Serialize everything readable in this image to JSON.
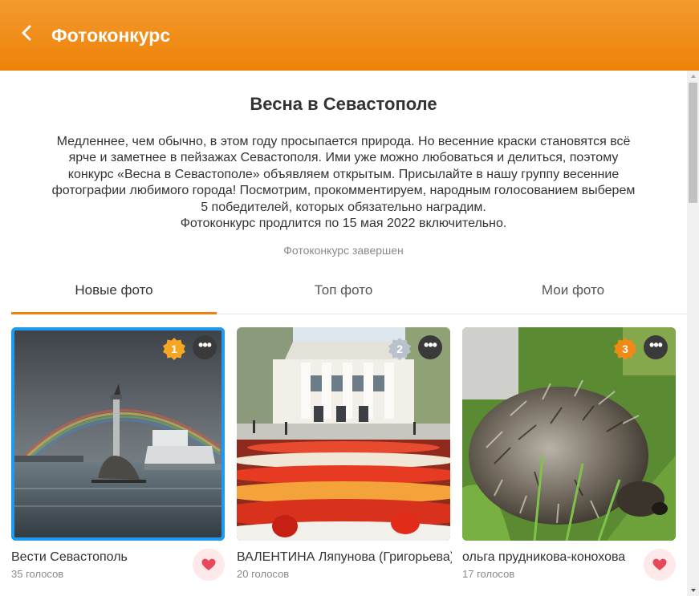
{
  "header": {
    "title": "Фотоконкурс",
    "back_icon": "chevron-left-icon"
  },
  "contest": {
    "title": "Весна в Севастополе",
    "description_lines": [
      "Медленнее, чем обычно, в этом году просыпается природа. Но весенние краски становятся всё",
      "ярче и заметнее в пейзажах Севастополя. Ими уже можно любоваться и делиться, поэтому",
      "конкурс «Весна в Севастополе» объявляем открытым. Присылайте в нашу группу весенние",
      "фотографии любимого города! Посмотрим, прокомментируем, народным голосованием выберем",
      "5 победителей, которых обязательно наградим.",
      "Фотоконкурс продлится по 15 мая 2022 включительно."
    ],
    "status": "Фотоконкурс завершен"
  },
  "tabs": [
    {
      "label": "Новые фото",
      "active": true
    },
    {
      "label": "Топ фото",
      "active": false
    },
    {
      "label": "Мои фото",
      "active": false
    }
  ],
  "photos": [
    {
      "rank": "1",
      "author": "Вести Севастополь",
      "votes": "35 голосов",
      "selected": true,
      "badge_color": "#f5a623",
      "subject": "monument-rainbow"
    },
    {
      "rank": "2",
      "author": "ВАЛЕНТИНА Ляпунова (Григорьева)",
      "votes": "20 голосов",
      "selected": false,
      "badge_color": "#b9c2cc",
      "subject": "theater-tulips"
    },
    {
      "rank": "3",
      "author": "ольга прудникова-конохова",
      "votes": "17 голосов",
      "selected": false,
      "badge_color": "#f08a14",
      "subject": "hedgehog"
    }
  ],
  "colors": {
    "accent": "#ee8208",
    "selection": "#1e9bf0",
    "like": "#e8495a"
  },
  "icons": {
    "more": "more-dots-icon",
    "like": "heart-icon",
    "badge": "rank-badge-icon"
  }
}
